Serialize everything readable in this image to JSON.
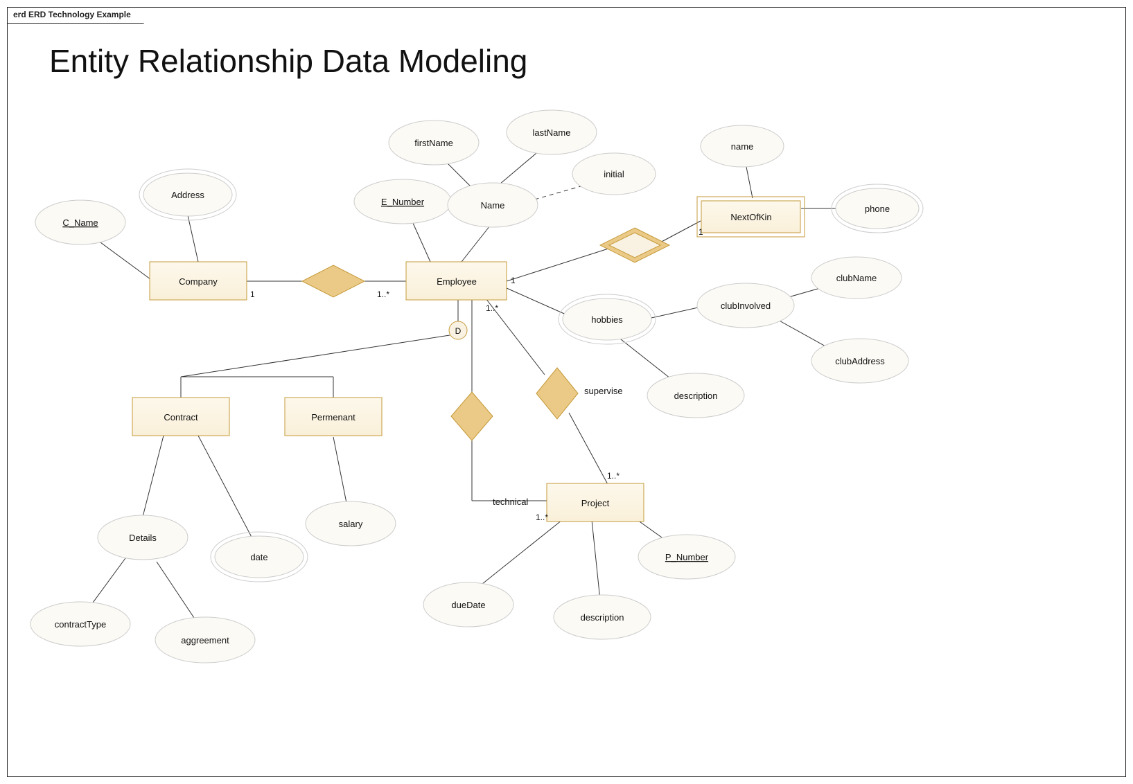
{
  "tab_title": "erd ERD Technology Example",
  "page_title": "Entity Relationship Data Modeling",
  "entities": {
    "company": "Company",
    "employee": "Employee",
    "nextofkin": "NextOfKin",
    "contract": "Contract",
    "permenant": "Permenant",
    "project": "Project"
  },
  "attributes": {
    "c_name": "C_Name",
    "address": "Address",
    "e_number": "E_Number",
    "name": "Name",
    "firstName": "firstName",
    "lastName": "lastName",
    "initial": "initial",
    "kin_name": "name",
    "kin_phone": "phone",
    "hobbies": "hobbies",
    "clubInvolved": "clubInvolved",
    "clubName": "clubName",
    "clubAddress": "clubAddress",
    "hobby_desc": "description",
    "details": "Details",
    "contractType": "contractType",
    "aggreement": "aggreement",
    "date": "date",
    "salary": "salary",
    "p_number": "P_Number",
    "dueDate": "dueDate",
    "proj_desc": "description"
  },
  "relationships": {
    "supervise": "supervise",
    "technical": "technical"
  },
  "cardinality": {
    "one": "1",
    "one_many": "1..*"
  },
  "disjoint": "D",
  "diagram": {
    "type": "ERD (Chen notation)",
    "entities": [
      {
        "name": "Company",
        "attributes": [
          {
            "name": "C_Name",
            "key": true
          },
          {
            "name": "Address",
            "multivalued": true
          }
        ]
      },
      {
        "name": "Employee",
        "attributes": [
          {
            "name": "E_Number",
            "key": true
          },
          {
            "name": "Name",
            "composite_of": [
              "firstName",
              "lastName",
              "initial"
            ]
          },
          {
            "name": "hobbies",
            "multivalued": true,
            "attributes": [
              {
                "name": "description"
              },
              {
                "name": "clubInvolved",
                "attributes": [
                  "clubName",
                  "clubAddress"
                ]
              }
            ]
          }
        ],
        "subtypes_disjoint": [
          "Contract",
          "Permenant"
        ]
      },
      {
        "name": "Contract",
        "attributes": [
          {
            "name": "Details",
            "attributes": [
              "contractType",
              "aggreement"
            ]
          },
          {
            "name": "date",
            "multivalued": true
          }
        ]
      },
      {
        "name": "Permenant",
        "attributes": [
          {
            "name": "salary"
          }
        ]
      },
      {
        "name": "NextOfKin",
        "weak": true,
        "attributes": [
          {
            "name": "name"
          },
          {
            "name": "phone",
            "multivalued": true
          }
        ]
      },
      {
        "name": "Project",
        "attributes": [
          {
            "name": "P_Number",
            "key": true
          },
          {
            "name": "dueDate"
          },
          {
            "name": "description"
          }
        ]
      }
    ],
    "relationships": [
      {
        "between": [
          "Company",
          "Employee"
        ],
        "cardinality": [
          "1",
          "1..*"
        ]
      },
      {
        "between": [
          "Employee",
          "NextOfKin"
        ],
        "identifying": true,
        "cardinality": [
          "1",
          "1"
        ]
      },
      {
        "name": "supervise",
        "between": [
          "Employee",
          "Project"
        ],
        "cardinality": [
          "1..*",
          "1..*"
        ]
      },
      {
        "name": "technical",
        "between": [
          "Employee",
          "Project"
        ],
        "cardinality": [
          "",
          "1..*"
        ]
      }
    ]
  }
}
